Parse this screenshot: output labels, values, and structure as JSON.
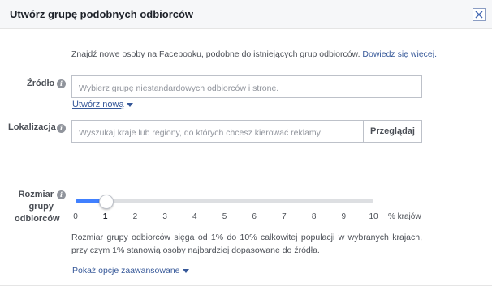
{
  "dialog": {
    "title": "Utwórz grupę podobnych odbiorców"
  },
  "intro": {
    "text": "Znajdź nowe osoby na Facebooku, podobne do istniejących grup odbiorców.",
    "link": "Dowiedz się więcej."
  },
  "source": {
    "label": "Źródło",
    "placeholder": "Wybierz grupę niestandardowych odbiorców i stronę.",
    "create_link": "Utwórz nową"
  },
  "location": {
    "label": "Lokalizacja",
    "placeholder": "Wyszukaj kraje lub regiony, do których chcesz kierować reklamy",
    "browse_label": "Przeglądaj"
  },
  "audience_size": {
    "label_line1": "Rozmiar",
    "label_line2": "grupy",
    "label_line3": "odbiorców",
    "selected_value": 1,
    "min": 0,
    "max": 10,
    "ticks": [
      "0",
      "1",
      "2",
      "3",
      "4",
      "5",
      "6",
      "7",
      "8",
      "9",
      "10"
    ],
    "unit": "% krajów",
    "description": "Rozmiar grupy odbiorców sięga od 1% do 10% całkowitej populacji w wybranych krajach, przy czym 1% stanowią osoby najbardziej dopasowane do źródła.",
    "advanced_link": "Pokaż opcje zaawansowane"
  },
  "colors": {
    "accent": "#4080ff",
    "link": "#365899",
    "header_bg": "#f6f7f9"
  }
}
